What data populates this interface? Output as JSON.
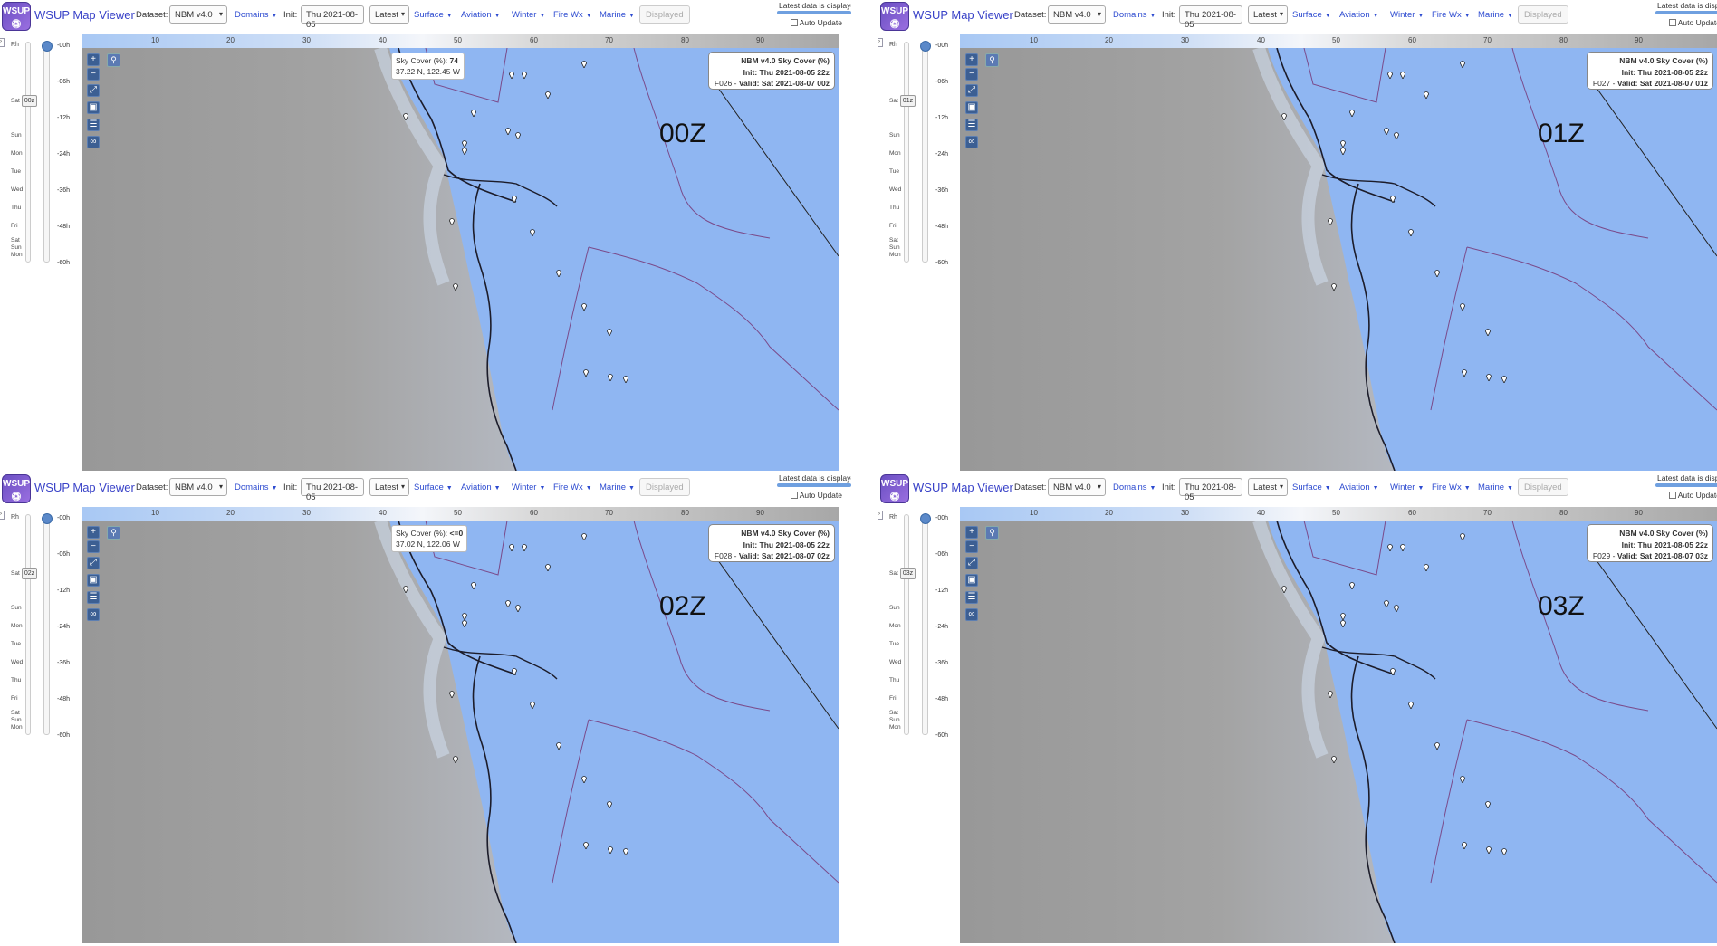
{
  "app": {
    "title": "WSUP Map Viewer",
    "logo": "WSUP",
    "dataset_label": "Dataset:",
    "dataset_value": "NBM v4.0",
    "init_label": "Init:",
    "init_value": "Thu 2021-08-05",
    "latest_value": "Latest",
    "menus": [
      "Domains",
      "Surface",
      "Aviation",
      "Winter",
      "Fire Wx",
      "Marine"
    ],
    "displayed_button": "Displayed",
    "latest_notice": "Latest data is displayed",
    "auto_update": "Auto Update"
  },
  "timeline": {
    "rh_label": "Rh",
    "days": [
      "Sat",
      "Sun",
      "Mon",
      "Tue",
      "Wed",
      "Thu",
      "Fri",
      "Sat",
      "Sun",
      "Mon"
    ],
    "hours": [
      "-00h",
      "-06h",
      "-12h",
      "-24h",
      "-36h",
      "-48h",
      "-60h"
    ]
  },
  "ruler_ticks": [
    "10",
    "20",
    "30",
    "40",
    "50",
    "60",
    "70",
    "80",
    "90"
  ],
  "colors": {
    "accent": "#3a43c8",
    "map_blue": "#8fb6f2",
    "cloud_gray": "#9a9a9a",
    "border_purple": "#7a4a8a"
  },
  "icons": [
    "zoom-in-icon",
    "zoom-out-icon",
    "expand-icon",
    "image-icon",
    "layers-icon",
    "link-icon",
    "magnifier-icon",
    "station-pin-icon"
  ],
  "panels": [
    {
      "hour": "00Z",
      "day_handle": "00z",
      "legend_title": "NBM v4.0 Sky Cover (%)",
      "legend_init": "Init: Thu 2021-08-05 22z",
      "legend_fhour": "F026",
      "legend_valid": "Valid: Sat 2021-08-07 00z",
      "tooltip_label": "Sky Cover (%): ",
      "tooltip_value": "74",
      "tooltip_coords": "37.22 N, 122.45 W"
    },
    {
      "hour": "01Z",
      "day_handle": "01z",
      "legend_title": "NBM v4.0 Sky Cover (%)",
      "legend_init": "Init: Thu 2021-08-05 22z",
      "legend_fhour": "F027",
      "legend_valid": "Valid: Sat 2021-08-07 01z",
      "tooltip_label": "",
      "tooltip_value": "",
      "tooltip_coords": ""
    },
    {
      "hour": "02Z",
      "day_handle": "02z",
      "legend_title": "NBM v4.0 Sky Cover (%)",
      "legend_init": "Init: Thu 2021-08-05 22z",
      "legend_fhour": "F028",
      "legend_valid": "Valid: Sat 2021-08-07 02z",
      "tooltip_label": "Sky Cover (%): ",
      "tooltip_value": "<=0",
      "tooltip_coords": "37.02 N, 122.06 W"
    },
    {
      "hour": "03Z",
      "day_handle": "03z",
      "legend_title": "NBM v4.0 Sky Cover (%)",
      "legend_init": "Init: Thu 2021-08-05 22z",
      "legend_fhour": "F029",
      "legend_valid": "Valid: Sat 2021-08-07 03z",
      "tooltip_label": "",
      "tooltip_value": "",
      "tooltip_coords": ""
    }
  ]
}
